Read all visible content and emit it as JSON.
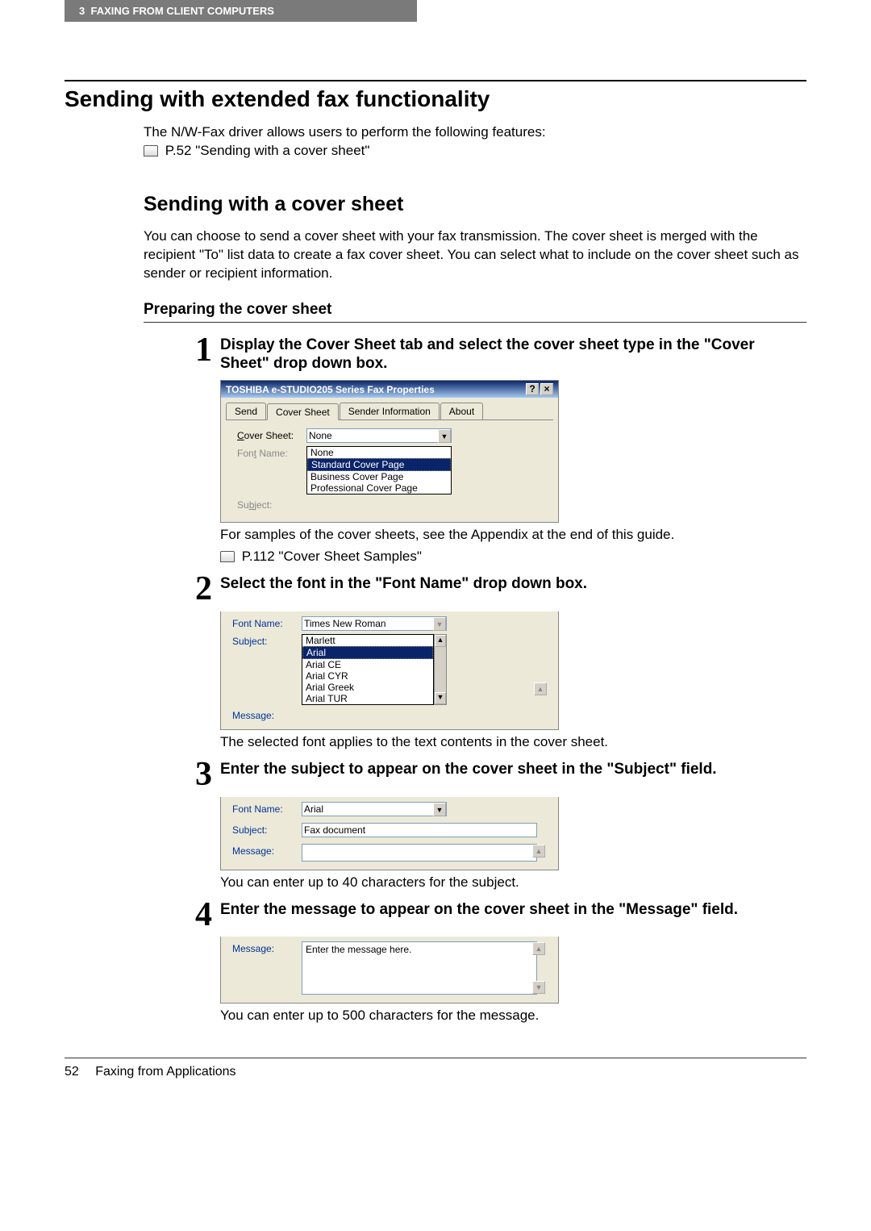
{
  "header": {
    "chapter": "3",
    "chapter_title": "FAXING FROM CLIENT COMPUTERS"
  },
  "h1": "Sending with extended fax functionality",
  "intro_line1": "The N/W-Fax driver allows users to perform the following features:",
  "intro_ref": "P.52 \"Sending with a cover sheet\"",
  "h2": "Sending with a cover sheet",
  "p1": "You can choose to send a cover sheet with your fax transmission. The cover sheet is merged with the recipient \"To\" list data to create a fax cover sheet. You can select what to include on the cover sheet such as sender or recipient information.",
  "h3": "Preparing the cover sheet",
  "steps": {
    "s1": {
      "num": "1",
      "txt": "Display the Cover Sheet tab and select the cover sheet type in the \"Cover Sheet\" drop down box."
    },
    "s2": {
      "num": "2",
      "txt": "Select the font in the \"Font Name\" drop down box."
    },
    "s3": {
      "num": "3",
      "txt": "Enter the subject to appear on the cover sheet in the \"Subject\" field."
    },
    "s4": {
      "num": "4",
      "txt": "Enter the message to appear on the cover sheet in the \"Message\" field."
    }
  },
  "notes": {
    "n1a": "For samples of the cover sheets, see the Appendix at the end of this guide.",
    "n1b": "P.112 \"Cover Sheet Samples\"",
    "n2": "The selected font applies to the text contents in the cover sheet.",
    "n3": "You can enter up to 40 characters for the subject.",
    "n4": "You can enter up to 500 characters for the message."
  },
  "dlg1": {
    "title": "TOSHIBA e-STUDIO205 Series Fax Properties",
    "help": "?",
    "close": "×",
    "tabs": {
      "send": "Send",
      "cover": "Cover Sheet",
      "sender": "Sender Information",
      "about": "About"
    },
    "labels": {
      "cover": "Cover Sheet:",
      "font": "Font Name:",
      "subject": "Subject:"
    },
    "combo_val": "None",
    "opts": {
      "o1": "None",
      "o2": "Standard Cover Page",
      "o3": "Business Cover Page",
      "o4": "Professional Cover Page"
    }
  },
  "dlg2": {
    "labels": {
      "font": "Font Name:",
      "subject": "Subject:",
      "message": "Message:"
    },
    "combo_val": "Times New Roman",
    "opts": {
      "o1": "Marlett",
      "o2": "Arial",
      "o3": "Arial CE",
      "o4": "Arial CYR",
      "o5": "Arial Greek",
      "o6": "Arial TUR"
    }
  },
  "dlg3": {
    "labels": {
      "font": "Font Name:",
      "subject": "Subject:",
      "message": "Message:"
    },
    "font_val": "Arial",
    "subject_val": "Fax document"
  },
  "dlg4": {
    "labels": {
      "message": "Message:"
    },
    "message_val": "Enter the message here."
  },
  "footer": {
    "page_num": "52",
    "section": "Faxing from Applications"
  }
}
